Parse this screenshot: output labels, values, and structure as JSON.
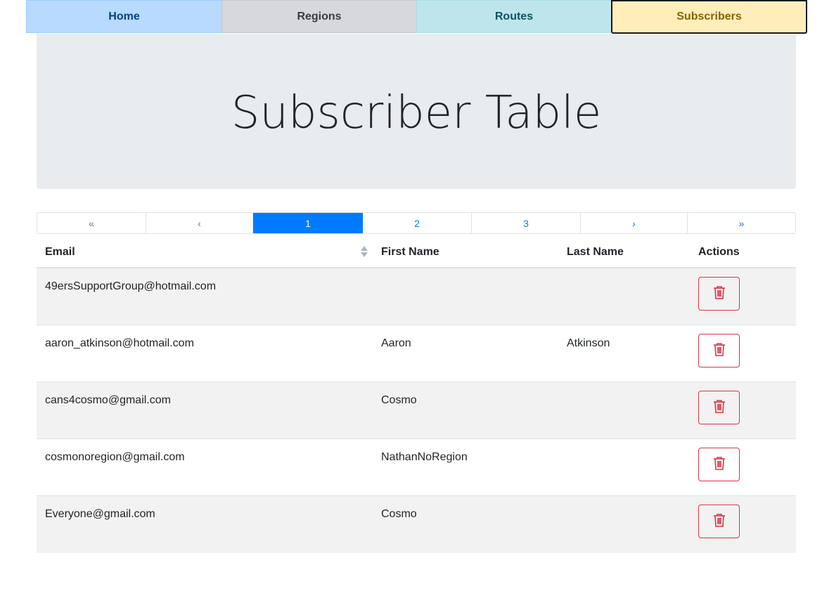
{
  "nav": {
    "tabs": [
      {
        "label": "Home"
      },
      {
        "label": "Regions"
      },
      {
        "label": "Routes"
      },
      {
        "label": "Subscribers"
      }
    ]
  },
  "jumbotron": {
    "title": "Subscriber Table"
  },
  "pagination": {
    "first": "«",
    "prev": "‹",
    "pages": [
      "1",
      "2",
      "3"
    ],
    "current_page": "1",
    "next": "›",
    "last": "»"
  },
  "table": {
    "columns": [
      "Email",
      "First Name",
      "Last Name",
      "Actions"
    ],
    "sorted_column": "Email",
    "rows": [
      {
        "email": "49ersSupportGroup@hotmail.com",
        "first_name": "",
        "last_name": ""
      },
      {
        "email": "aaron_atkinson@hotmail.com",
        "first_name": "Aaron",
        "last_name": "Atkinson"
      },
      {
        "email": "cans4cosmo@gmail.com",
        "first_name": "Cosmo",
        "last_name": ""
      },
      {
        "email": "cosmonoregion@gmail.com",
        "first_name": "NathanNoRegion",
        "last_name": ""
      },
      {
        "email": "Everyone@gmail.com",
        "first_name": "Cosmo",
        "last_name": ""
      }
    ],
    "row_action_icon": "trash-icon"
  },
  "colors": {
    "primary": "#007bff",
    "danger": "#dc3545",
    "jumbotron_bg": "#e9ecef",
    "tab_home": "#b8daff",
    "tab_regions": "#d6d8db",
    "tab_routes": "#bee5eb",
    "tab_subscribers": "#ffeeba"
  }
}
